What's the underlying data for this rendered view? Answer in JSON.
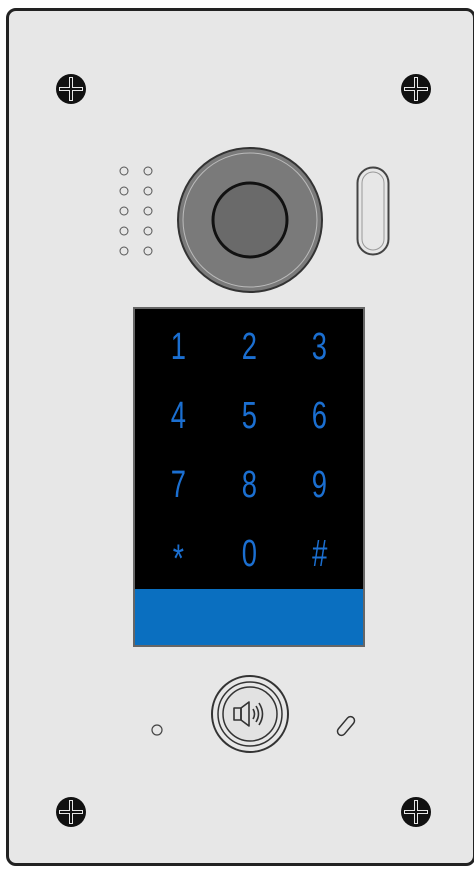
{
  "device": "door-station",
  "colors": {
    "panel": "#e7e7e7",
    "outline": "#222222",
    "keypad_background": "#000000",
    "key_digits": "#1b6fd1",
    "display_bar": "#0a6fc0"
  },
  "keypad": {
    "keys": [
      "1",
      "2",
      "3",
      "4",
      "5",
      "6",
      "7",
      "8",
      "9",
      "*",
      "0",
      "#"
    ]
  },
  "icons": {
    "call_button": "speaker-icon",
    "screws": "screw-icon",
    "camera": "camera-lens-icon",
    "mic": "microphone-hole-icon",
    "led": "unlock-indicator-icon",
    "grille": "speaker-grille-icon"
  }
}
